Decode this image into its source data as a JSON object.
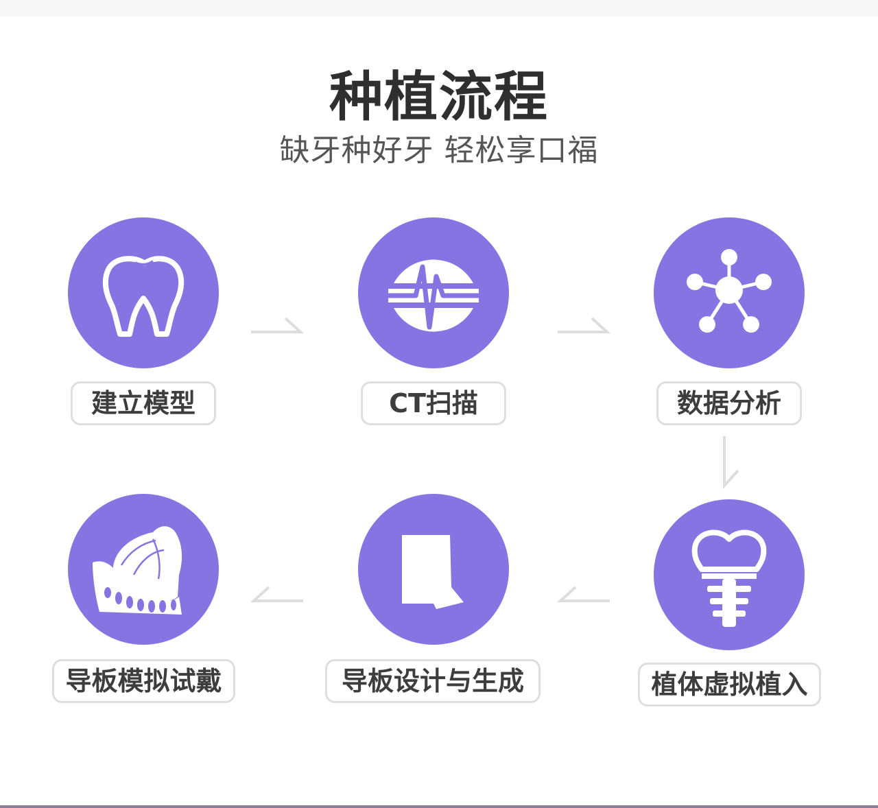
{
  "header": {
    "title": "种植流程",
    "subtitle": "缺牙种好牙 轻松享口福"
  },
  "steps": [
    {
      "label": "建立模型",
      "icon": "tooth-icon"
    },
    {
      "label": "CT扫描",
      "icon": "heartbeat-scan-icon"
    },
    {
      "label": "数据分析",
      "icon": "network-nodes-icon"
    },
    {
      "label": "植体虚拟植入",
      "icon": "dental-implant-icon"
    },
    {
      "label": "导板设计与生成",
      "icon": "document-icon"
    },
    {
      "label": "导板模拟试戴",
      "icon": "denture-icon"
    }
  ],
  "colors": {
    "accent": "#8674e2",
    "title": "#2f2f2f",
    "subtitle": "#555555",
    "label_border": "#dedede",
    "arrow": "#dddddd"
  }
}
